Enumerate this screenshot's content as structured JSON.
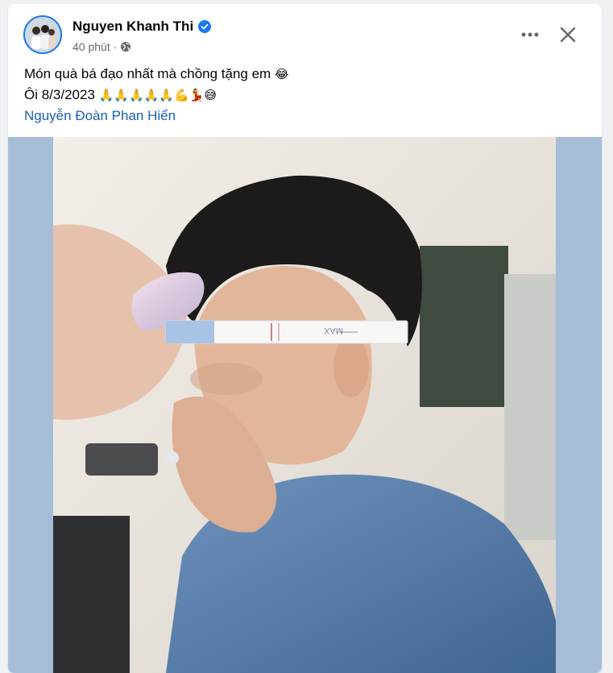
{
  "post": {
    "author": "Nguyen Khanh Thi",
    "time": "40 phút",
    "separator": "·",
    "text_line1": "Món quà bá đạo nhất mà chồng tặng em",
    "text_line1_emoji": "😂",
    "text_line2": "Ôi 8/3/2023",
    "text_line2_emoji": "🙏🙏🙏🙏🙏💪💃😅",
    "tag": "Nguyễn Đoàn Phan Hiển",
    "test_strip_label": "MAX"
  },
  "icons": {
    "verified": "verified-badge-icon",
    "privacy": "globe-icon",
    "more": "more-options-icon",
    "close": "close-icon"
  },
  "colors": {
    "accent": "#1877f2",
    "tag_link": "#1a5fb4",
    "photo_background": "#a6bdd7"
  }
}
